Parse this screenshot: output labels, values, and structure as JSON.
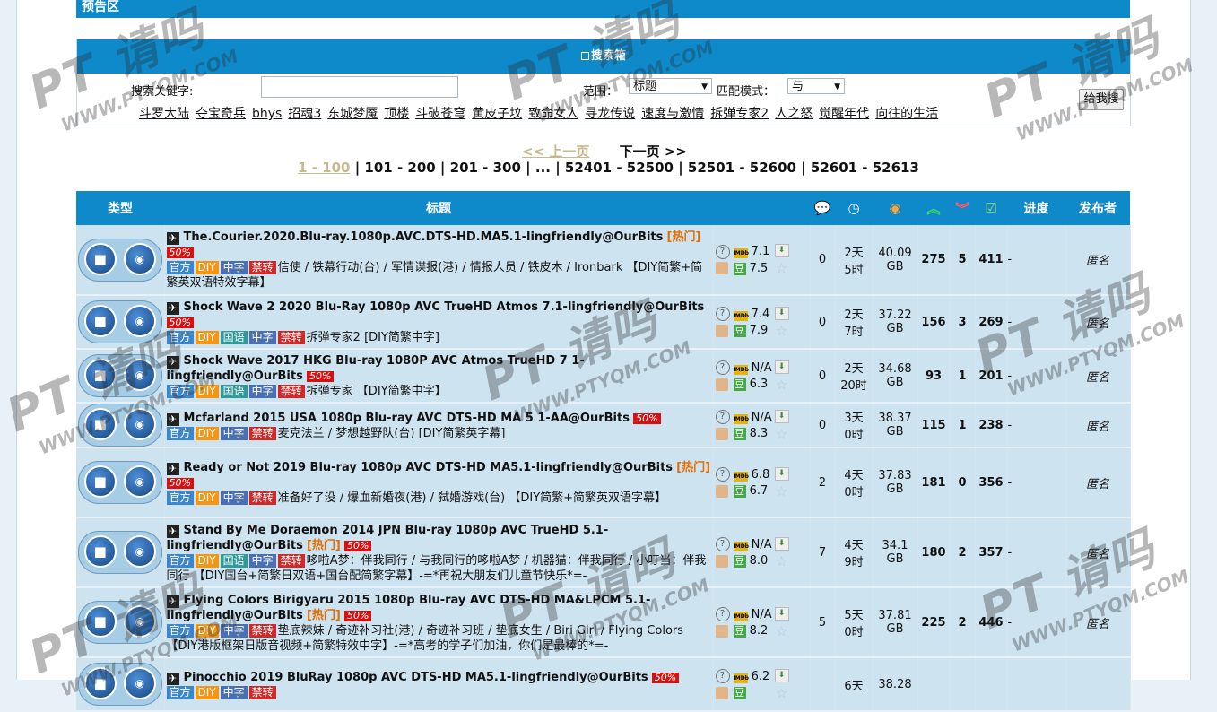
{
  "top_title": "预告区",
  "search": {
    "title": "搜索箱",
    "keyword_label": "搜索关键字:",
    "keyword_value": "",
    "scope_label": "范围：",
    "scope_value": "标题",
    "match_label": "匹配模式：",
    "match_value": "与",
    "button": "给我搜",
    "hot_keywords": [
      "斗罗大陆",
      "夺宝奇兵",
      "bhys",
      "招魂3",
      "东城梦魇",
      "顶楼",
      "斗破苍穹",
      "黄皮子坟",
      "致命女人",
      "寻龙传说",
      "速度与激情",
      "拆弹专家2",
      "人之怒",
      "觉醒年代",
      "向往的生活"
    ]
  },
  "pager": {
    "prev": "<< 上一页",
    "next": "下一页 >>",
    "current": "1 - 100",
    "pages": [
      "101 - 200",
      "201 - 300",
      "...",
      "52401 - 52500",
      "52501 - 52600",
      "52601 - 52613"
    ],
    "sep": " | "
  },
  "table": {
    "headers": {
      "type": "类型",
      "title": "标题",
      "comments_icon": "comment-icon",
      "time_icon": "clock-icon",
      "size_icon": "size-icon",
      "seeders_icon": "seeders-icon",
      "leechers_icon": "leechers-icon",
      "completed_icon": "completed-icon",
      "progress": "进度",
      "uploader": "发布者"
    },
    "rows": [
      {
        "name": "The.Courier.2020.Blu-ray.1080p.AVC.DTS-HD.MA5.1-lingfriendly@OurBits",
        "hot": "[热门]",
        "pct": "50%",
        "tags": [
          "官方",
          "DIY",
          "中字",
          "禁转"
        ],
        "desc": "信使 / 铁幕行动(台) / 军情谍报(港) / 情报人员 / 铁皮木 / Ironbark 【DIY简繁+简繁英双语特效字幕】",
        "imdb": "7.1",
        "douban": "7.5",
        "comments": "0",
        "time1": "2天",
        "time2": "5时",
        "size1": "40.09",
        "size2": "GB",
        "seeders": "275",
        "leechers": "5",
        "completed": "411",
        "progress": "-",
        "uploader": "匿名",
        "h": 78
      },
      {
        "name": "Shock Wave 2 2020 Blu-Ray 1080p AVC TrueHD Atmos 7.1-lingfriendly@OurBits",
        "hot": "",
        "pct": "50%",
        "tags": [
          "官方",
          "DIY",
          "国语",
          "中字",
          "禁转"
        ],
        "desc": "拆弹专家2 [DIY简繁中字]",
        "imdb": "7.4",
        "douban": "7.9",
        "comments": "0",
        "time1": "2天",
        "time2": "7时",
        "size1": "37.22",
        "size2": "GB",
        "seeders": "156",
        "leechers": "3",
        "completed": "269",
        "progress": "-",
        "uploader": "匿名",
        "h": 60
      },
      {
        "name": "Shock Wave 2017 HKG Blu-ray 1080P AVC Atmos TrueHD 7 1-lingfriendly@OurBits",
        "hot": "",
        "pct": "50%",
        "tags": [
          "官方",
          "DIY",
          "国语",
          "中字",
          "禁转"
        ],
        "desc": "拆弹专家 【DIY简繁中字】",
        "imdb": "N/A",
        "douban": "6.3",
        "comments": "0",
        "time1": "2天",
        "time2": "20时",
        "size1": "34.68",
        "size2": "GB",
        "seeders": "93",
        "leechers": "1",
        "completed": "201",
        "progress": "-",
        "uploader": "匿名",
        "h": 60
      },
      {
        "name": "Mcfarland 2015 USA 1080p Blu-ray AVC DTS-HD MA 5 1-AA@OurBits",
        "hot": "",
        "pct": "50%",
        "tags": [
          "官方",
          "DIY",
          "中字",
          "禁转"
        ],
        "desc": "麦克法兰 / 梦想越野队(台) [DIY简繁英字幕]",
        "imdb": "N/A",
        "douban": "8.3",
        "comments": "0",
        "time1": "3天",
        "time2": "0时",
        "size1": "38.37",
        "size2": "GB",
        "seeders": "115",
        "leechers": "1",
        "completed": "238",
        "progress": "-",
        "uploader": "匿名",
        "h": 50
      },
      {
        "name": "Ready or Not 2019 Blu-ray 1080p AVC DTS-HD MA5.1-lingfriendly@OurBits",
        "hot": "[热门]",
        "pct": "50%",
        "tags": [
          "官方",
          "DIY",
          "中字",
          "禁转"
        ],
        "desc": "准备好了没 / 爆血新婚夜(港) / 弑婚游戏(台) 【DIY简繁+简繁英双语字幕】",
        "imdb": "6.8",
        "douban": "6.7",
        "comments": "2",
        "time1": "4天",
        "time2": "0时",
        "size1": "37.83",
        "size2": "GB",
        "seeders": "181",
        "leechers": "0",
        "completed": "356",
        "progress": "-",
        "uploader": "匿名",
        "h": 78
      },
      {
        "name": "Stand By Me Doraemon 2014 JPN Blu-ray 1080p AVC TrueHD 5.1-lingfriendly@OurBits",
        "hot": "[热门]",
        "pct": "50%",
        "tags": [
          "官方",
          "DIY",
          "国语",
          "中字",
          "禁转"
        ],
        "desc": "哆啦A梦：伴我同行 / 与我同行的哆啦A梦 / 机器猫：伴我同行 / 小叮当：伴我同行 【DIY国台+简繁日双语+国台配简繁字幕】-=*再祝大朋友们儿童节快乐*=-",
        "imdb": "N/A",
        "douban": "8.0",
        "comments": "7",
        "time1": "4天",
        "time2": "9时",
        "size1": "34.1",
        "size2": "GB",
        "seeders": "180",
        "leechers": "2",
        "completed": "357",
        "progress": "-",
        "uploader": "匿名",
        "h": 78
      },
      {
        "name": "Flying Colors Birigyaru 2015 1080p Blu-ray AVC DTS-HD MA&LPCM 5.1-lingfriendly@OurBits",
        "hot": "[热门]",
        "pct": "50%",
        "tags": [
          "官方",
          "DIY",
          "中字",
          "禁转"
        ],
        "desc": "垫底辣妹 / 奇迹补习社(港) / 奇迹补习班 / 垫底女生 / Biri Girl / Flying Colors 【DIY港版框架日版音视频+简繁特效中字】-=*高考的学子们加油，你们是最棒的*=-",
        "imdb": "N/A",
        "douban": "8.2",
        "comments": "5",
        "time1": "5天",
        "time2": "0时",
        "size1": "37.81",
        "size2": "GB",
        "seeders": "225",
        "leechers": "2",
        "completed": "446",
        "progress": "-",
        "uploader": "匿名",
        "h": 78
      },
      {
        "name": "Pinocchio 2019 BluRay 1080p AVC DTS-HD MA5.1-lingfriendly@OurBits",
        "hot": "",
        "pct": "50%",
        "tags": [
          "官方",
          "DIY",
          "中字",
          "禁转"
        ],
        "desc": "",
        "imdb": "6.2",
        "douban": "",
        "comments": "",
        "time1": "6天",
        "time2": "",
        "size1": "38.28",
        "size2": "",
        "seeders": "",
        "leechers": "",
        "completed": "",
        "progress": "",
        "uploader": "",
        "h": 60
      }
    ]
  },
  "watermark": {
    "logo": "PT 请吗",
    "url": "WWW.PTYQM.COM"
  },
  "colors": {
    "header_blue": "#0e8acb",
    "row_bg": "#cde3f0",
    "hot": "#e56d00",
    "pct_red": "#d71010"
  }
}
